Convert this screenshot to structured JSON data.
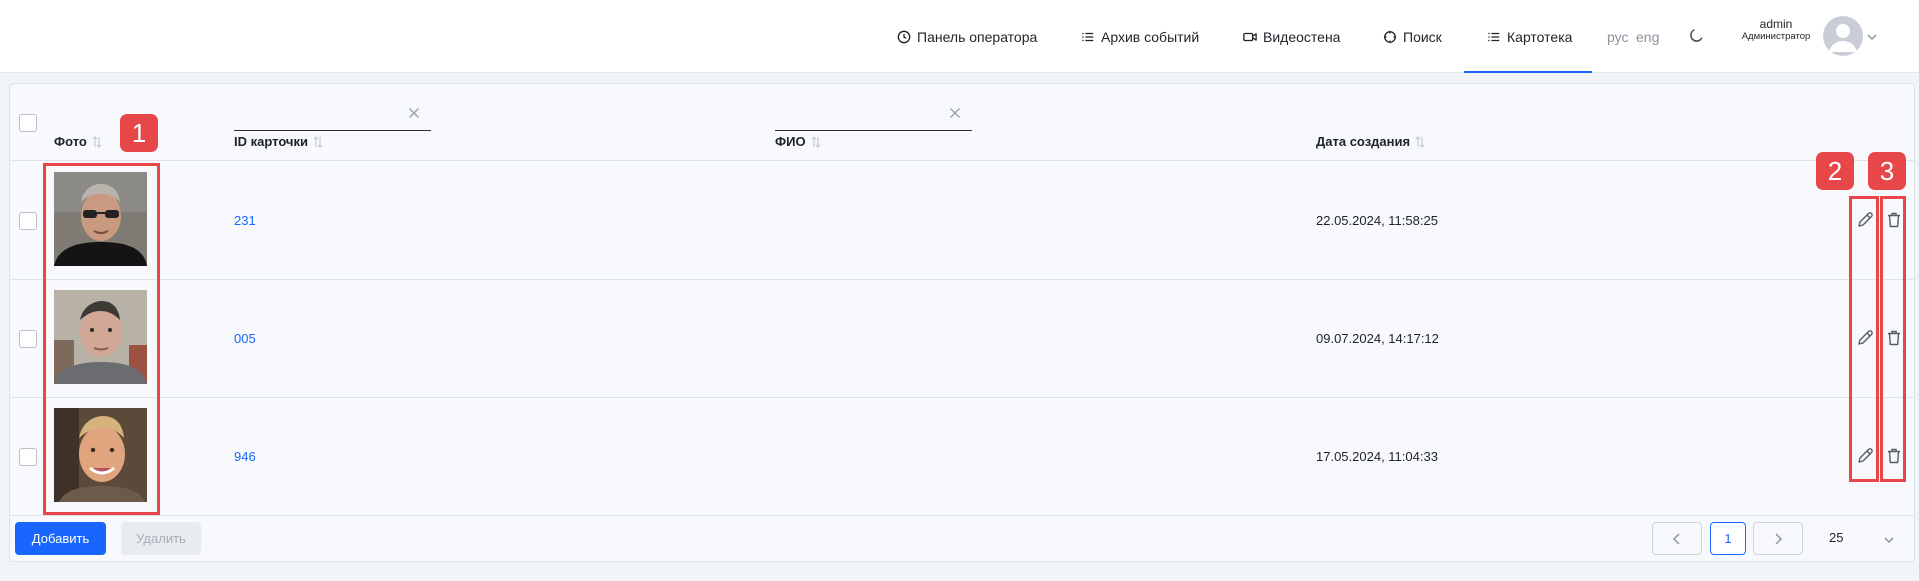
{
  "nav": {
    "items": [
      {
        "label": "Панель оператора",
        "icon": "clock-icon"
      },
      {
        "label": "Архив событий",
        "icon": "list-icon"
      },
      {
        "label": "Видеостена",
        "icon": "camera-icon"
      },
      {
        "label": "Поиск",
        "icon": "target-icon"
      },
      {
        "label": "Картотека",
        "icon": "list-icon"
      }
    ],
    "active": "Картотека",
    "lang_ru": "рус",
    "lang_en": "eng",
    "user_name": "admin",
    "user_role": "Администратор",
    "accent_color": "#1966ff"
  },
  "table": {
    "columns": {
      "photo": "Фото",
      "id": "ID карточки",
      "fio": "ФИО",
      "created": "Дата создания"
    },
    "rows": [
      {
        "id": "231",
        "fio": "",
        "created": "22.05.2024, 11:58:25"
      },
      {
        "id": "005",
        "fio": "",
        "created": "09.07.2024, 14:17:12"
      },
      {
        "id": "946",
        "fio": "",
        "created": "17.05.2024, 11:04:33"
      }
    ]
  },
  "annotations": {
    "badge1": "1",
    "badge2": "2",
    "badge3": "3",
    "color": "#e8474a"
  },
  "footer": {
    "add_label": "Добавить",
    "delete_label": "Удалить",
    "current_page": "1",
    "page_size": "25"
  }
}
